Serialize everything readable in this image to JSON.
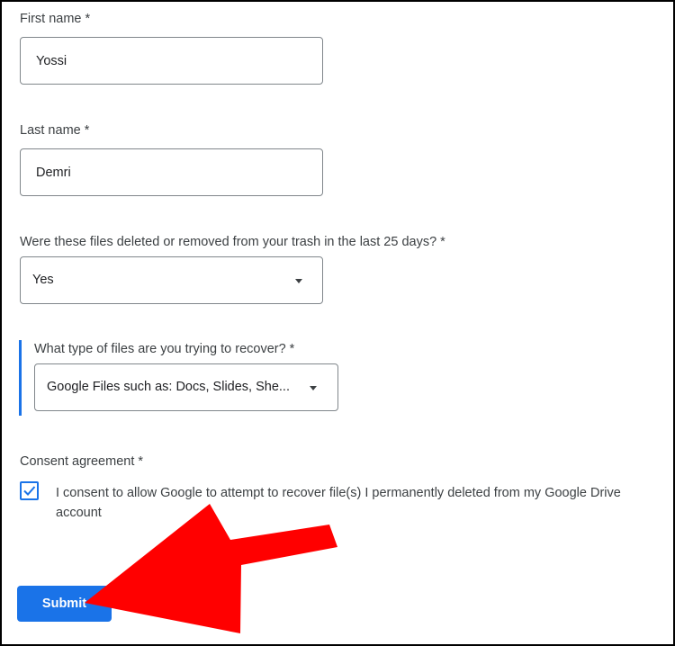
{
  "form": {
    "first_name": {
      "label": "First name *",
      "value": "Yossi"
    },
    "last_name": {
      "label": "Last name *",
      "value": "Demri"
    },
    "deleted_question": {
      "label": "Were these files deleted or removed from your trash in the last 25 days? *",
      "selected": "Yes"
    },
    "file_type_question": {
      "label": "What type of files are you trying to recover? *",
      "selected": "Google Files such as: Docs, Slides, She..."
    },
    "consent": {
      "label": "Consent agreement *",
      "text": "I consent to allow Google to attempt to recover file(s) I permanently deleted from my Google Drive account",
      "checked": true
    },
    "submit_label": "Submit"
  },
  "colors": {
    "accent": "#1a73e8",
    "annotation_arrow": "#ff0000"
  },
  "icons": {
    "dropdown": "caret-down-icon",
    "checkbox": "checkmark-icon",
    "annotation": "red-arrow-icon"
  }
}
